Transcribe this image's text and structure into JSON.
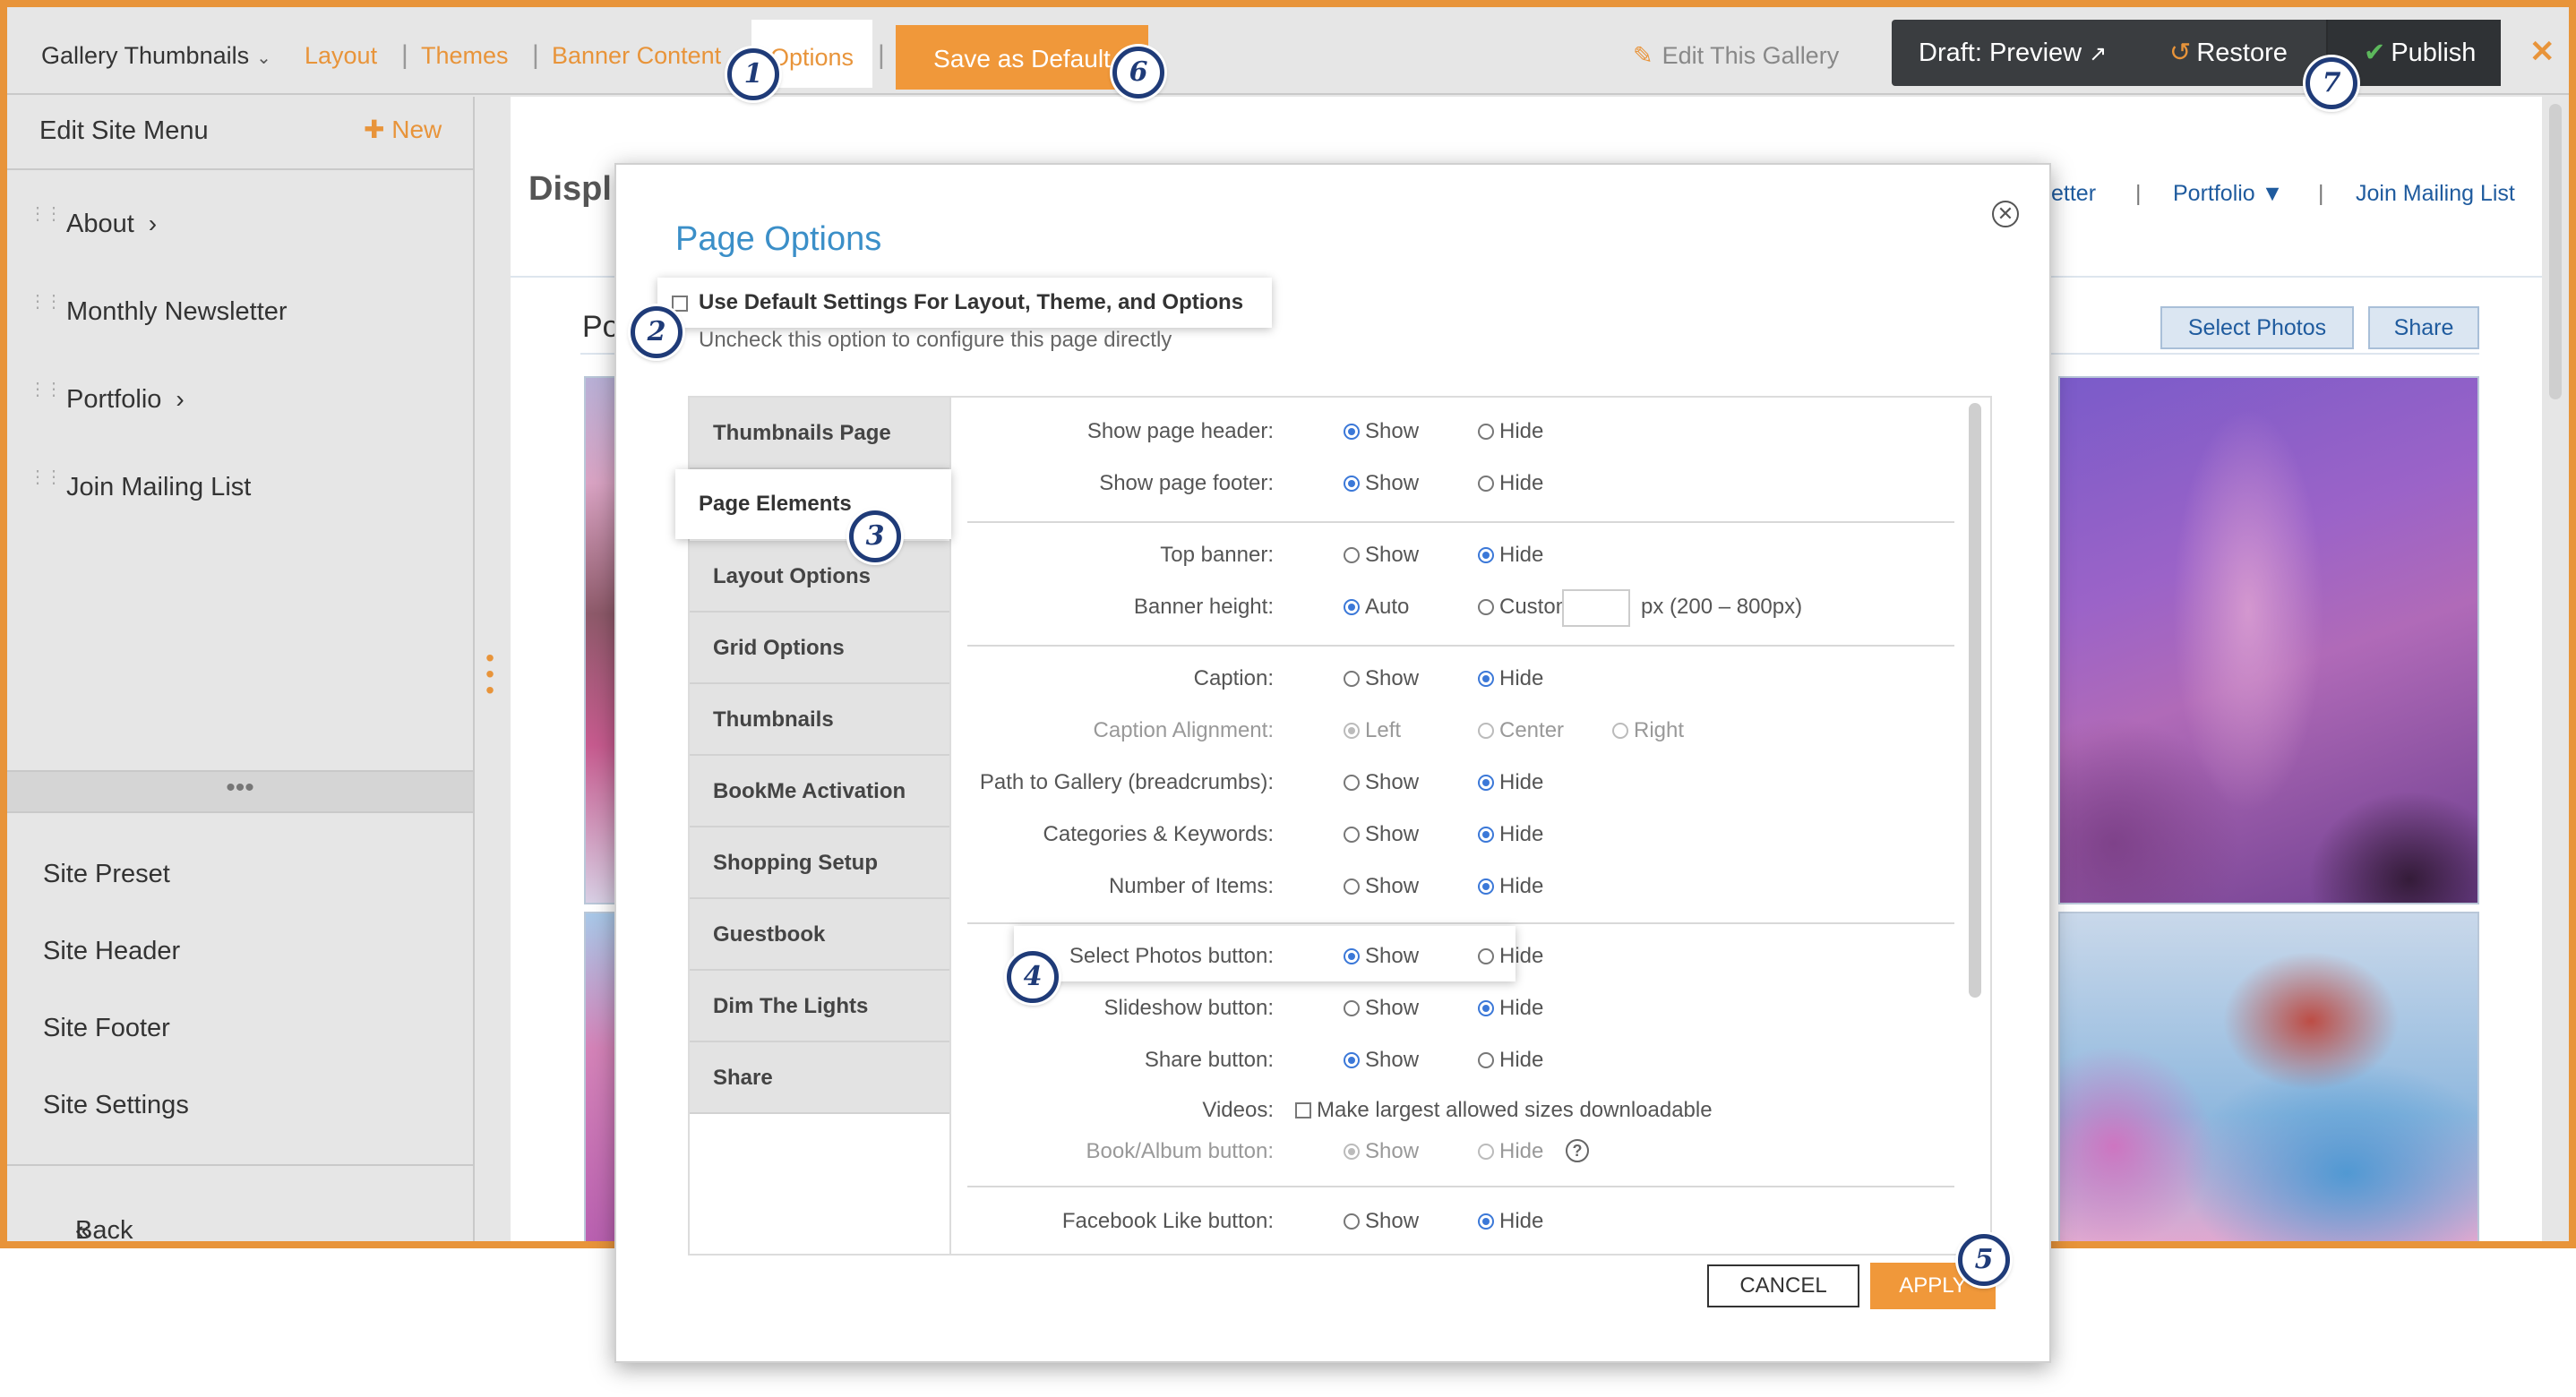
{
  "topbar": {
    "gallery_title": "Gallery Thumbnails",
    "tabs": [
      "Layout",
      "Themes",
      "Banner Content"
    ],
    "active_tab": "Options",
    "save_default": "Save as Default",
    "edit_gallery": "Edit This Gallery",
    "draft_preview": "Draft: Preview",
    "restore": "Restore",
    "publish": "Publish"
  },
  "sidebar": {
    "title": "Edit Site Menu",
    "new_label": "New",
    "items": [
      {
        "label": "About",
        "has_arrow": true
      },
      {
        "label": "Monthly Newsletter",
        "has_arrow": false
      },
      {
        "label": "Portfolio",
        "has_arrow": true
      },
      {
        "label": "Join Mailing List",
        "has_arrow": false
      }
    ],
    "settings": [
      "Site Preset",
      "Site Header",
      "Site Footer",
      "Site Settings"
    ],
    "back": "Back to Editor"
  },
  "preview": {
    "title_fragment": "Displ",
    "nav": [
      "etter",
      "Portfolio ▼",
      "Join Mailing List"
    ],
    "section_fragment": "Po",
    "select_photos": "Select Photos",
    "share": "Share"
  },
  "modal": {
    "title": "Page Options",
    "default_label": "Use Default Settings For Layout, Theme, and Options",
    "default_checked": false,
    "default_help": "Uncheck this option to configure this page directly",
    "tabs": [
      "Thumbnails Page",
      "Page Elements",
      "Layout Options",
      "Grid Options",
      "Thumbnails",
      "BookMe Activation",
      "Shopping Setup",
      "Guestbook",
      "Dim The Lights",
      "Share"
    ],
    "active_tab": "Page Elements",
    "opt_show": "Show",
    "opt_hide": "Hide",
    "opt_auto": "Auto",
    "opt_custom": "Custom",
    "opt_left": "Left",
    "opt_center": "Center",
    "opt_right": "Right",
    "banner_unit": "px  (200 – 800px)",
    "videos_option": "Make largest allowed sizes downloadable",
    "rows": {
      "page_header": "Show page header:",
      "page_footer": "Show page footer:",
      "top_banner": "Top banner:",
      "banner_height": "Banner height:",
      "caption": "Caption:",
      "caption_alignment": "Caption Alignment:",
      "breadcrumbs": "Path to Gallery (breadcrumbs):",
      "categories": "Categories & Keywords:",
      "num_items": "Number of Items:",
      "select_photos": "Select Photos button:",
      "slideshow": "Slideshow button:",
      "share": "Share button:",
      "videos": "Videos:",
      "book_album": "Book/Album button:",
      "facebook": "Facebook Like button:"
    },
    "cancel": "CANCEL",
    "apply": "APPLY"
  },
  "callouts": [
    "1",
    "2",
    "3",
    "4",
    "5",
    "6",
    "7"
  ],
  "colors": {
    "accent": "#e8943a",
    "dark": "#3a3d40",
    "link": "#1f5b9e",
    "title_blue": "#3b8fc8",
    "callout": "#1f3b78"
  }
}
